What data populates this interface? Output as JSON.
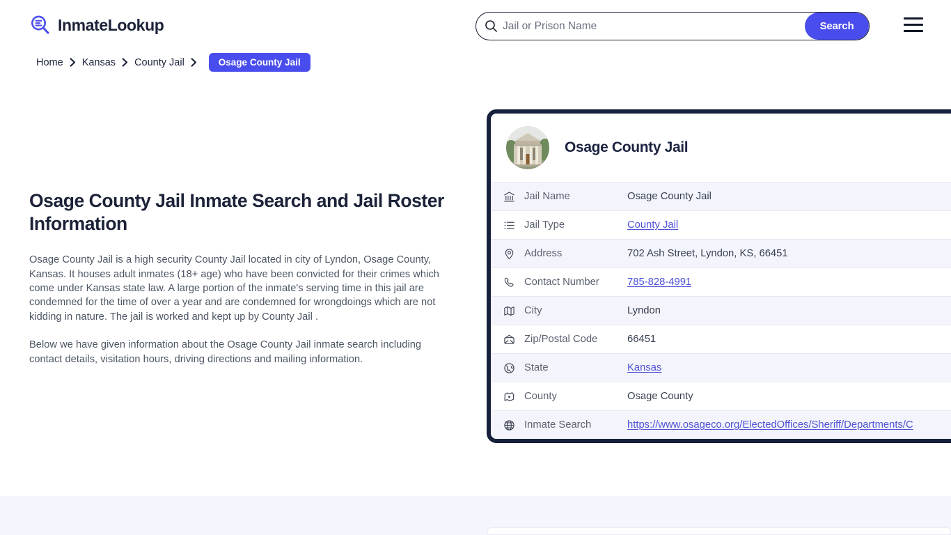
{
  "brand": {
    "name": "InmateLookup",
    "logo_icon": "magnifier-list-icon",
    "accent_color": "#4a4ded",
    "dark_color": "#16203c"
  },
  "search": {
    "placeholder": "Jail or Prison Name",
    "value": "",
    "button_label": "Search",
    "icon": "search-icon"
  },
  "menu": {
    "icon": "hamburger-menu-icon"
  },
  "breadcrumb": {
    "items": [
      {
        "label": "Home"
      },
      {
        "label": "Kansas"
      },
      {
        "label": "County Jail"
      }
    ],
    "current": "Osage County Jail",
    "separator_icon": "chevron-right-icon"
  },
  "main": {
    "title": "Osage County Jail Inmate Search and Jail Roster Information",
    "paragraphs": [
      "Osage County Jail is a high security County Jail located in city of Lyndon, Osage County, Kansas. It houses adult inmates (18+ age) who have been convicted for their crimes which come under Kansas state law. A large portion of the inmate's serving time in this jail are condemned for the time of over a year and are condemned for wrongdoings which are not kidding in nature. The jail is worked and kept up by County Jail .",
      "Below we have given information about the Osage County Jail inmate search including contact details, visitation hours, driving directions and mailing information."
    ]
  },
  "card": {
    "title": "Osage County Jail",
    "avatar_icon": "courthouse-photo",
    "rows": [
      {
        "icon": "bank-icon",
        "label": "Jail Name",
        "value": "Osage County Jail",
        "is_link": false
      },
      {
        "icon": "list-icon",
        "label": "Jail Type",
        "value": "County Jail",
        "is_link": true
      },
      {
        "icon": "map-pin-icon",
        "label": "Address",
        "value": "702 Ash Street, Lyndon, KS, 66451",
        "is_link": false
      },
      {
        "icon": "phone-icon",
        "label": "Contact Number",
        "value": "785-828-4991",
        "is_link": true
      },
      {
        "icon": "map-icon",
        "label": "City",
        "value": "Lyndon",
        "is_link": false
      },
      {
        "icon": "envelope-icon",
        "label": "Zip/Postal Code",
        "value": "66451",
        "is_link": false
      },
      {
        "icon": "globe-state-icon",
        "label": "State",
        "value": "Kansas",
        "is_link": true
      },
      {
        "icon": "county-icon",
        "label": "County",
        "value": "Osage County",
        "is_link": false
      },
      {
        "icon": "globe-icon",
        "label": "Inmate Search",
        "value": "https://www.osageco.org/ElectedOffices/Sheriff/Departments/C",
        "is_link": true
      }
    ]
  }
}
